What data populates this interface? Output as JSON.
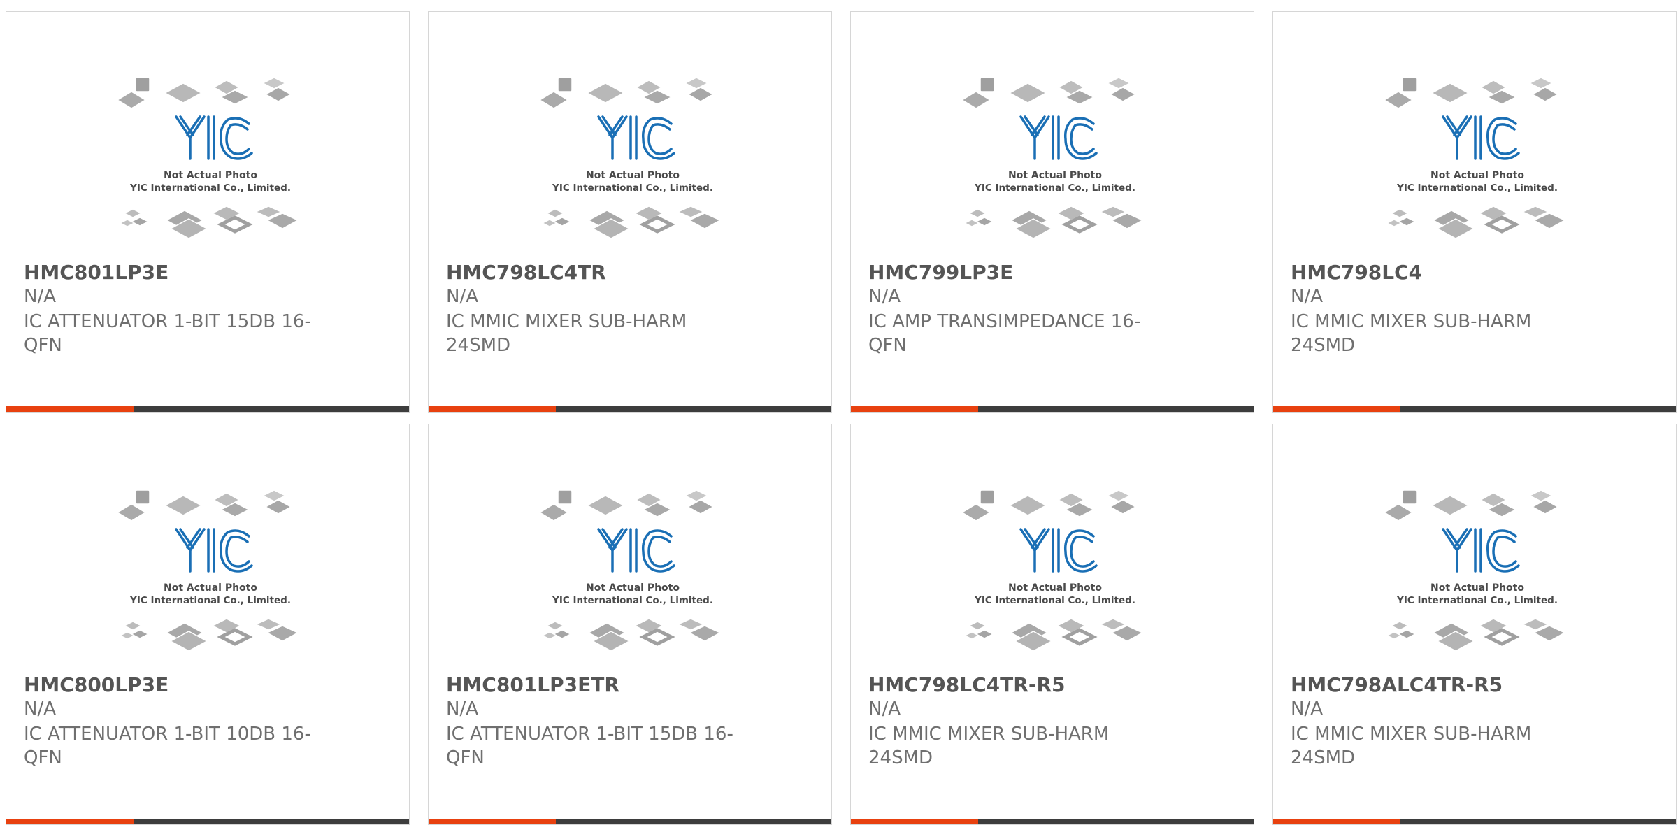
{
  "products": [
    {
      "part_number": "HMC801LP3E",
      "status": "N/A",
      "description": "IC ATTENUATOR 1-BIT 15DB 16-QFN",
      "photo": {
        "logo": "YIC",
        "caption1": "Not Actual Photo",
        "caption2": "YIC International Co., Limited."
      }
    },
    {
      "part_number": "HMC798LC4TR",
      "status": "N/A",
      "description": "IC MMIC MIXER SUB-HARM 24SMD",
      "photo": {
        "logo": "YIC",
        "caption1": "Not Actual Photo",
        "caption2": "YIC International Co., Limited."
      }
    },
    {
      "part_number": "HMC799LP3E",
      "status": "N/A",
      "description": "IC AMP TRANSIMPEDANCE 16-QFN",
      "photo": {
        "logo": "YIC",
        "caption1": "Not Actual Photo",
        "caption2": "YIC International Co., Limited."
      }
    },
    {
      "part_number": "HMC798LC4",
      "status": "N/A",
      "description": "IC MMIC MIXER SUB-HARM 24SMD",
      "photo": {
        "logo": "YIC",
        "caption1": "Not Actual Photo",
        "caption2": "YIC International Co., Limited."
      }
    },
    {
      "part_number": "HMC800LP3E",
      "status": "N/A",
      "description": "IC ATTENUATOR 1-BIT 10DB 16-QFN",
      "photo": {
        "logo": "YIC",
        "caption1": "Not Actual Photo",
        "caption2": "YIC International Co., Limited."
      }
    },
    {
      "part_number": "HMC801LP3ETR",
      "status": "N/A",
      "description": "IC ATTENUATOR 1-BIT 15DB 16-QFN",
      "photo": {
        "logo": "YIC",
        "caption1": "Not Actual Photo",
        "caption2": "YIC International Co., Limited."
      }
    },
    {
      "part_number": "HMC798LC4TR-R5",
      "status": "N/A",
      "description": "IC MMIC MIXER SUB-HARM 24SMD",
      "photo": {
        "logo": "YIC",
        "caption1": "Not Actual Photo",
        "caption2": "YIC International Co., Limited."
      }
    },
    {
      "part_number": "HMC798ALC4TR-R5",
      "status": "N/A",
      "description": "IC MMIC MIXER SUB-HARM 24SMD",
      "photo": {
        "logo": "YIC",
        "caption1": "Not Actual Photo",
        "caption2": "YIC International Co., Limited."
      }
    }
  ],
  "colors": {
    "accent": "#e8410f",
    "bar": "#3d3d3d",
    "logo": "#1a6fb5",
    "text": "#6f6f6f",
    "title": "#555555"
  },
  "icons": {
    "photo": "chip-placeholder-image",
    "logo": "yic-logo"
  }
}
